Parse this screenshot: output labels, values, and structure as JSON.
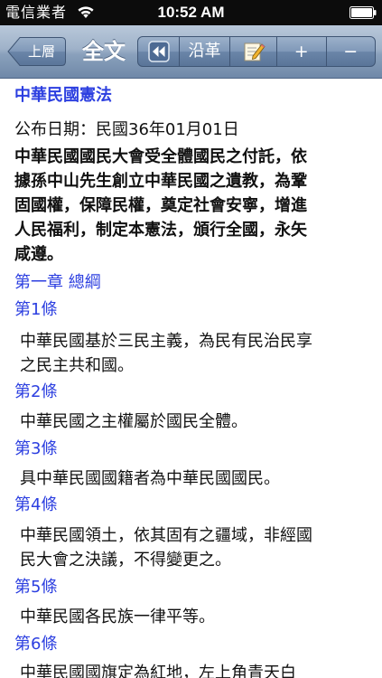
{
  "status_bar": {
    "carrier": "電信業者",
    "time": "10:52 AM",
    "wifi_icon": "wifi-icon",
    "battery_icon": "battery-icon"
  },
  "toolbar": {
    "back_label": "上層",
    "title": "全文",
    "rewind_icon": "rewind-icon",
    "history_label": "沿革",
    "note_icon": "note-icon",
    "zoom_in_label": "+",
    "zoom_out_label": "−"
  },
  "colors": {
    "link_blue": "#2c3fe0",
    "toolbar_top": "#b9c8da",
    "toolbar_bottom": "#6f88a8"
  },
  "document": {
    "title": "中華民國憲法",
    "publish_date": "公布日期：民國36年01月01日",
    "preamble_lines": [
      "中華民國國民大會受全體國民之付託，依",
      "據孫中山先生創立中華民國之遺教，為鞏",
      "固國權，保障民權，奠定社會安寧，增進",
      "人民福利，制定本憲法，頒行全國，永矢",
      "咸遵。"
    ],
    "chapter": "第一章 總綱",
    "articles": [
      {
        "label": "第1條",
        "lines": [
          "中華民國基於三民主義，為民有民治民享",
          "之民主共和國。"
        ]
      },
      {
        "label": "第2條",
        "lines": [
          "中華民國之主權屬於國民全體。"
        ]
      },
      {
        "label": "第3條",
        "lines": [
          "具中華民國國籍者為中華民國國民。"
        ]
      },
      {
        "label": "第4條",
        "lines": [
          "中華民國領土，依其固有之疆域，非經國",
          "民大會之決議，不得變更之。"
        ]
      },
      {
        "label": "第5條",
        "lines": [
          "中華民國各民族一律平等。"
        ]
      },
      {
        "label": "第6條",
        "lines": [
          "中華民國國旗定為紅地，左上角青天白"
        ]
      }
    ]
  }
}
